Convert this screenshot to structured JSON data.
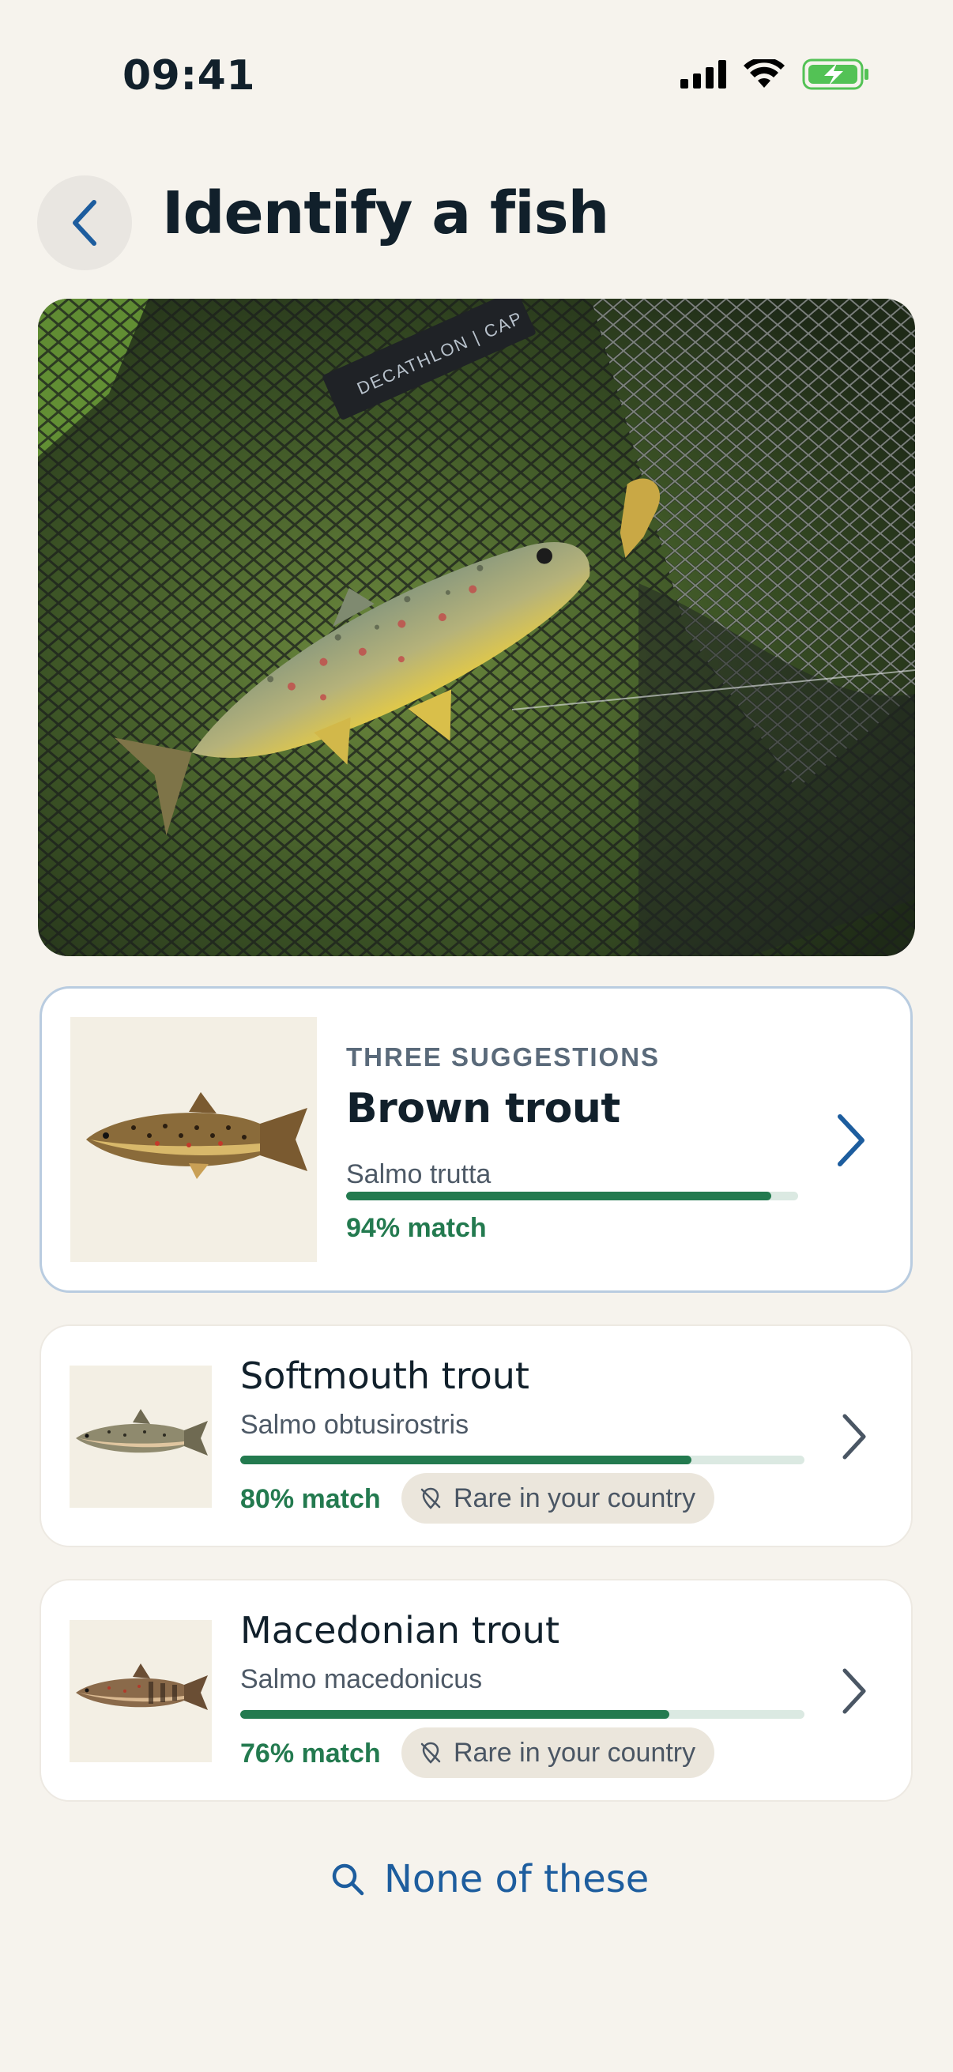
{
  "status_bar": {
    "time": "09:41",
    "icons": [
      "signal-icon",
      "wifi-icon",
      "battery-charging-icon"
    ]
  },
  "header": {
    "title": "Identify a fish",
    "back_icon": "chevron-left-icon"
  },
  "photo": {
    "label_text": "DECATHLON | CAP"
  },
  "suggestions": {
    "kicker": "THREE SUGGESTIONS",
    "items": [
      {
        "name": "Brown trout",
        "latin": "Salmo trutta",
        "match": 0.94,
        "match_label": "94% match"
      },
      {
        "name": "Softmouth trout",
        "latin": "Salmo obtusirostris",
        "match": 0.8,
        "match_label": "80% match",
        "badge": "Rare in your country"
      },
      {
        "name": "Macedonian trout",
        "latin": "Salmo macedonicus",
        "match": 0.76,
        "match_label": "76% match",
        "badge": "Rare in your country"
      }
    ]
  },
  "footer": {
    "none_label": "None of these",
    "icon": "search-icon"
  },
  "colors": {
    "background": "#f6f3ed",
    "accent": "#1d5d9e",
    "match_green": "#237a4f",
    "badge_bg": "#ebe6dc"
  }
}
